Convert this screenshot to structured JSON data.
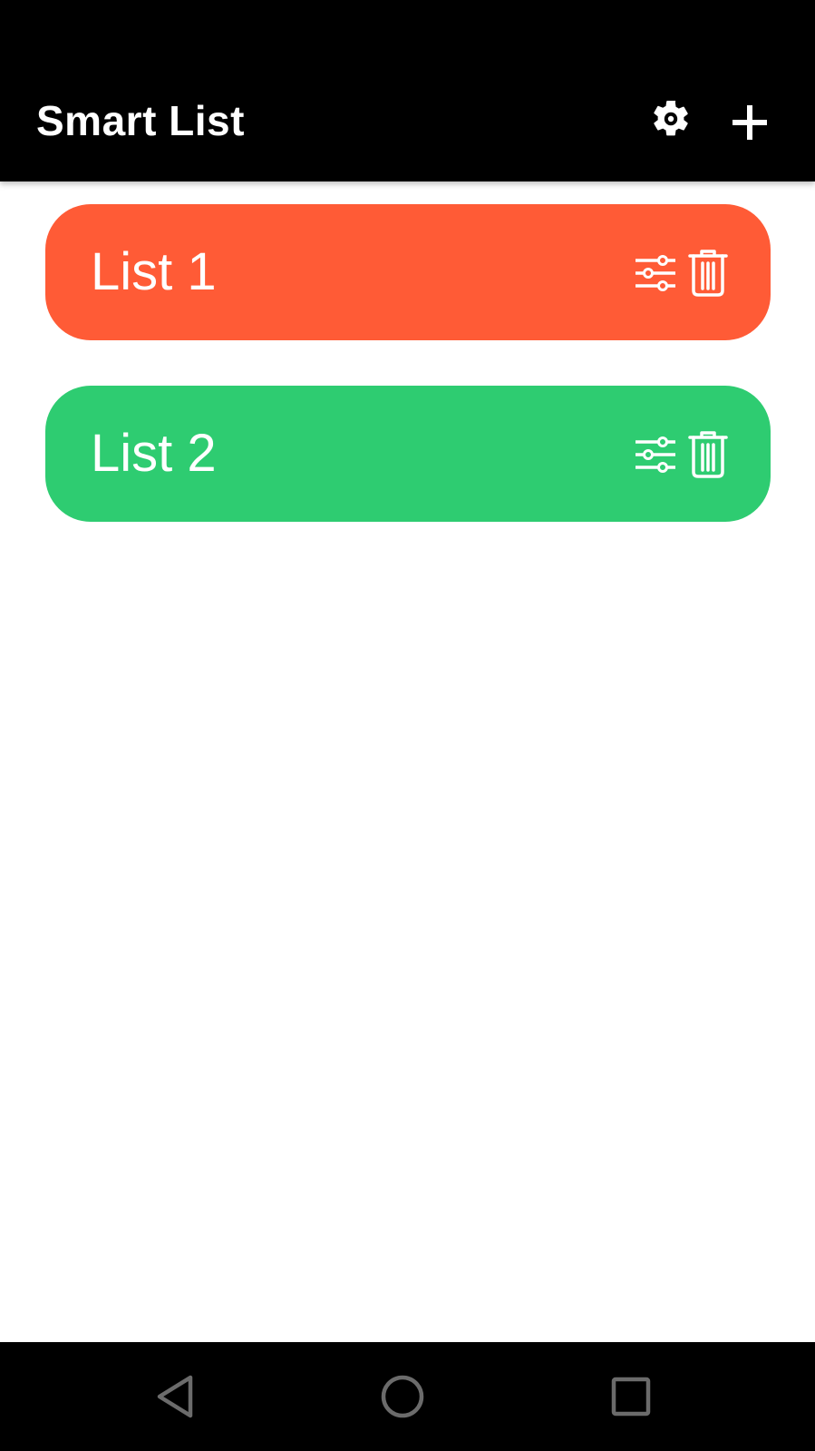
{
  "app_bar": {
    "title": "Smart List",
    "background": "#000000",
    "actions": [
      {
        "name": "settings",
        "icon": "gear-icon"
      },
      {
        "name": "add",
        "icon": "plus-icon"
      }
    ]
  },
  "lists": [
    {
      "name": "List 1",
      "color": "#FF5B36",
      "icons": [
        "sliders-icon",
        "trash-icon"
      ]
    },
    {
      "name": "List 2",
      "color": "#2ECC71",
      "icons": [
        "sliders-icon",
        "trash-icon"
      ]
    }
  ],
  "nav_bar": {
    "buttons": [
      "back-icon",
      "home-icon",
      "recents-icon"
    ],
    "icon_color": "#6b6b6b"
  }
}
